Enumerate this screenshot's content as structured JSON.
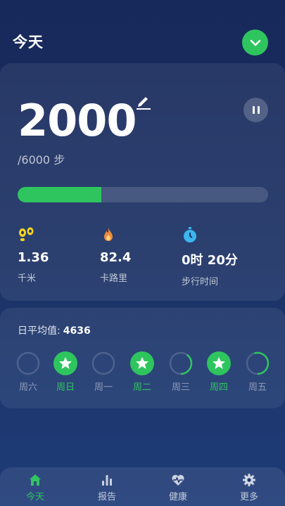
{
  "header": {
    "title": "今天"
  },
  "main": {
    "steps": "2000",
    "goal_text": "/6000 步",
    "progress": 0.333,
    "stats": [
      {
        "icon": "footprints-icon",
        "value": "1.36",
        "label": "千米"
      },
      {
        "icon": "flame-icon",
        "value": "82.4",
        "label": "卡路里"
      },
      {
        "icon": "stopwatch-icon",
        "value": "0时 20分",
        "label": "步行时间"
      }
    ]
  },
  "week": {
    "avg_label": "日平均值:",
    "avg_value": "4636",
    "days": [
      {
        "label": "周六",
        "status": "empty",
        "progress": 0
      },
      {
        "label": "周日",
        "status": "achieved",
        "progress": 1
      },
      {
        "label": "周一",
        "status": "empty",
        "progress": 0
      },
      {
        "label": "周二",
        "status": "achieved",
        "progress": 1
      },
      {
        "label": "周三",
        "status": "partial",
        "progress": 0.4
      },
      {
        "label": "周四",
        "status": "achieved",
        "progress": 1
      },
      {
        "label": "周五",
        "status": "partial",
        "progress": 0.55
      }
    ]
  },
  "tabs": [
    {
      "label": "今天",
      "icon": "home-icon",
      "active": true
    },
    {
      "label": "报告",
      "icon": "bar-chart-icon",
      "active": false
    },
    {
      "label": "健康",
      "icon": "heart-pulse-icon",
      "active": false
    },
    {
      "label": "更多",
      "icon": "gear-icon",
      "active": false
    }
  ],
  "colors": {
    "accent": "#2ec55e",
    "flame": "#f08a3c",
    "footprints": "#f5d420",
    "stopwatch": "#3bb6ef"
  }
}
